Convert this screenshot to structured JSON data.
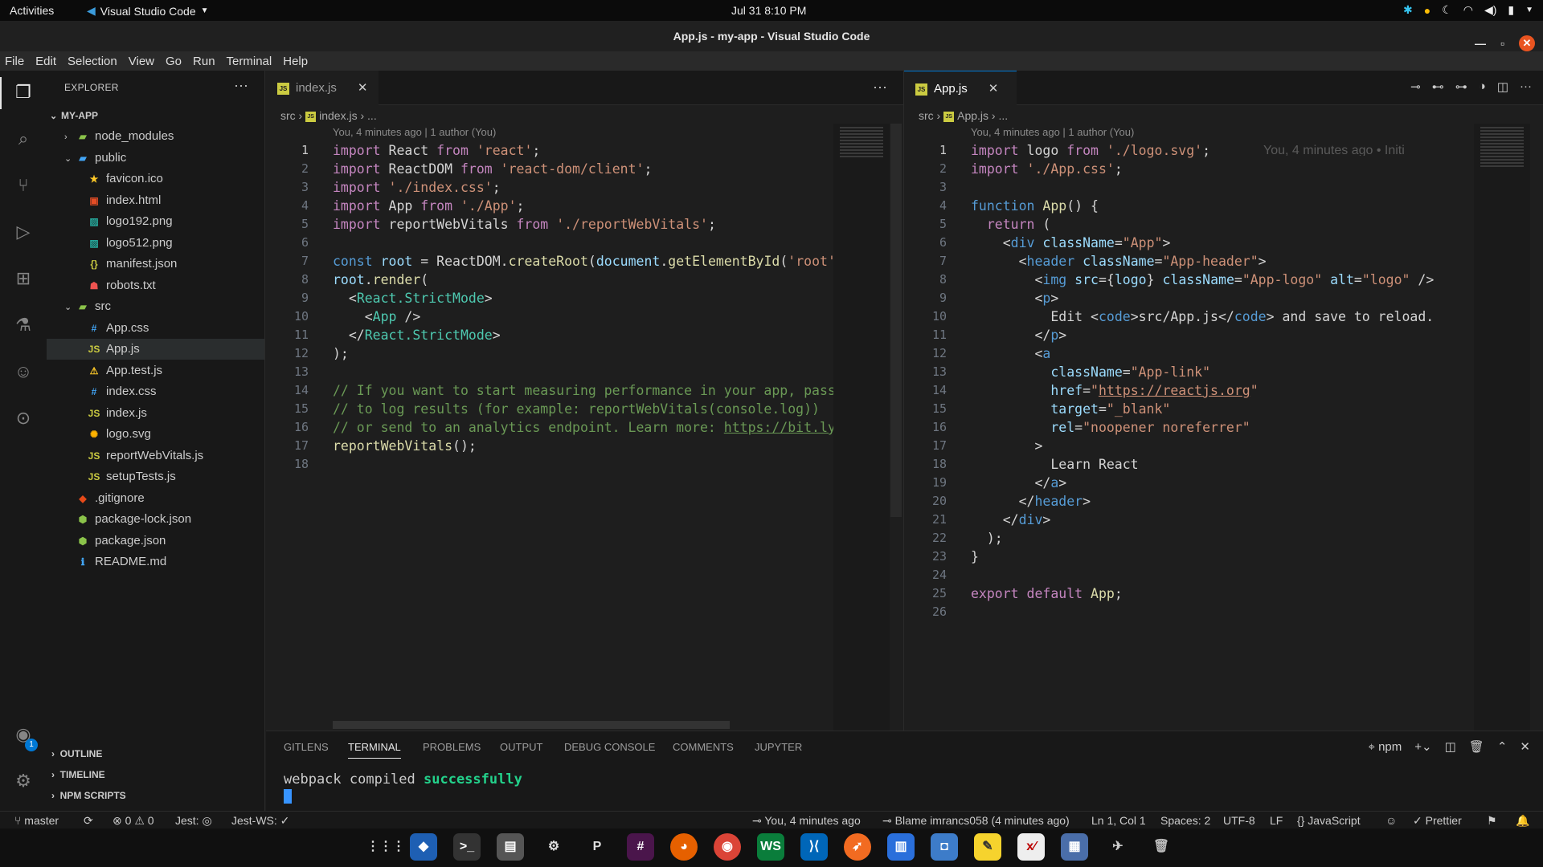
{
  "topbar": {
    "activities": "Activities",
    "app_name": "Visual Studio Code",
    "clock": "Jul 31  8:10 PM"
  },
  "window": {
    "title": "App.js - my-app - Visual Studio Code"
  },
  "menu": [
    "File",
    "Edit",
    "Selection",
    "View",
    "Go",
    "Run",
    "Terminal",
    "Help"
  ],
  "explorer": {
    "header": "EXPLORER",
    "root": "MY-APP",
    "items": [
      {
        "label": "node_modules",
        "icon": "folder-icon",
        "color": "#8bc34a"
      },
      {
        "label": "public",
        "icon": "folder-open-icon",
        "color": "#42a5f5"
      },
      {
        "label": "favicon.ico",
        "icon": "star-icon",
        "color": "#ffca28"
      },
      {
        "label": "index.html",
        "icon": "html-icon",
        "color": "#e44d26"
      },
      {
        "label": "logo192.png",
        "icon": "image-icon",
        "color": "#26a69a"
      },
      {
        "label": "logo512.png",
        "icon": "image-icon",
        "color": "#26a69a"
      },
      {
        "label": "manifest.json",
        "icon": "json-icon",
        "color": "#cbcb41"
      },
      {
        "label": "robots.txt",
        "icon": "robot-icon",
        "color": "#ef5350"
      },
      {
        "label": "src",
        "icon": "folder-open-icon",
        "color": "#8bc34a"
      },
      {
        "label": "App.css",
        "icon": "css-icon",
        "color": "#42a5f5"
      },
      {
        "label": "App.js",
        "icon": "js-icon",
        "color": "#cbcb41"
      },
      {
        "label": "App.test.js",
        "icon": "test-icon",
        "color": "#ffca28"
      },
      {
        "label": "index.css",
        "icon": "css-icon",
        "color": "#42a5f5"
      },
      {
        "label": "index.js",
        "icon": "js-icon",
        "color": "#cbcb41"
      },
      {
        "label": "logo.svg",
        "icon": "svg-icon",
        "color": "#ffb300"
      },
      {
        "label": "reportWebVitals.js",
        "icon": "js-icon",
        "color": "#cbcb41"
      },
      {
        "label": "setupTests.js",
        "icon": "js-icon",
        "color": "#cbcb41"
      },
      {
        "label": ".gitignore",
        "icon": "git-icon",
        "color": "#e64a19"
      },
      {
        "label": "package-lock.json",
        "icon": "npm-icon",
        "color": "#8bc34a"
      },
      {
        "label": "package.json",
        "icon": "npm-icon",
        "color": "#8bc34a"
      },
      {
        "label": "README.md",
        "icon": "info-icon",
        "color": "#42a5f5"
      }
    ],
    "sections": [
      "OUTLINE",
      "TIMELINE",
      "NPM SCRIPTS"
    ]
  },
  "editor_left": {
    "tab": "index.js",
    "breadcrumb": [
      "src",
      "index.js",
      "..."
    ],
    "blame": "You, 4 minutes ago | 1 author (You)",
    "line_numbers": [
      "1",
      "2",
      "3",
      "4",
      "5",
      "6",
      "7",
      "8",
      "9",
      "10",
      "11",
      "12",
      "13",
      "14",
      "15",
      "16",
      "17",
      "18"
    ]
  },
  "editor_right": {
    "tab": "App.js",
    "breadcrumb": [
      "src",
      "App.js",
      "..."
    ],
    "blame": "You, 4 minutes ago | 1 author (You)",
    "inline_blame": "You, 4 minutes ago • Initi",
    "line_numbers": [
      "1",
      "2",
      "3",
      "4",
      "5",
      "6",
      "7",
      "8",
      "9",
      "10",
      "11",
      "12",
      "13",
      "14",
      "15",
      "16",
      "17",
      "18",
      "19",
      "20",
      "21",
      "22",
      "23",
      "24",
      "25",
      "26"
    ]
  },
  "panel": {
    "tabs": [
      "GITLENS",
      "TERMINAL",
      "PROBLEMS",
      "OUTPUT",
      "DEBUG CONSOLE",
      "COMMENTS",
      "JUPYTER"
    ],
    "active_tab": "TERMINAL",
    "terminal_name": "npm",
    "terminal_text": "webpack compiled ",
    "terminal_status": "successfully"
  },
  "statusbar": {
    "branch": "master",
    "errors": "0",
    "warnings": "0",
    "jest": "Jest: ",
    "jest_ws": "Jest-WS: ✓",
    "commit_info": "You, 4 minutes ago",
    "blame": "Blame imrancs058 (4 minutes ago)",
    "position": "Ln 1, Col 1",
    "spaces": "Spaces: 2",
    "encoding": "UTF-8",
    "eol": "LF",
    "language": "JavaScript",
    "formatter": "Prettier"
  },
  "accounts_badge": "1",
  "colors": {
    "accent": "#0078d4",
    "terminal_success": "#23d18b"
  }
}
